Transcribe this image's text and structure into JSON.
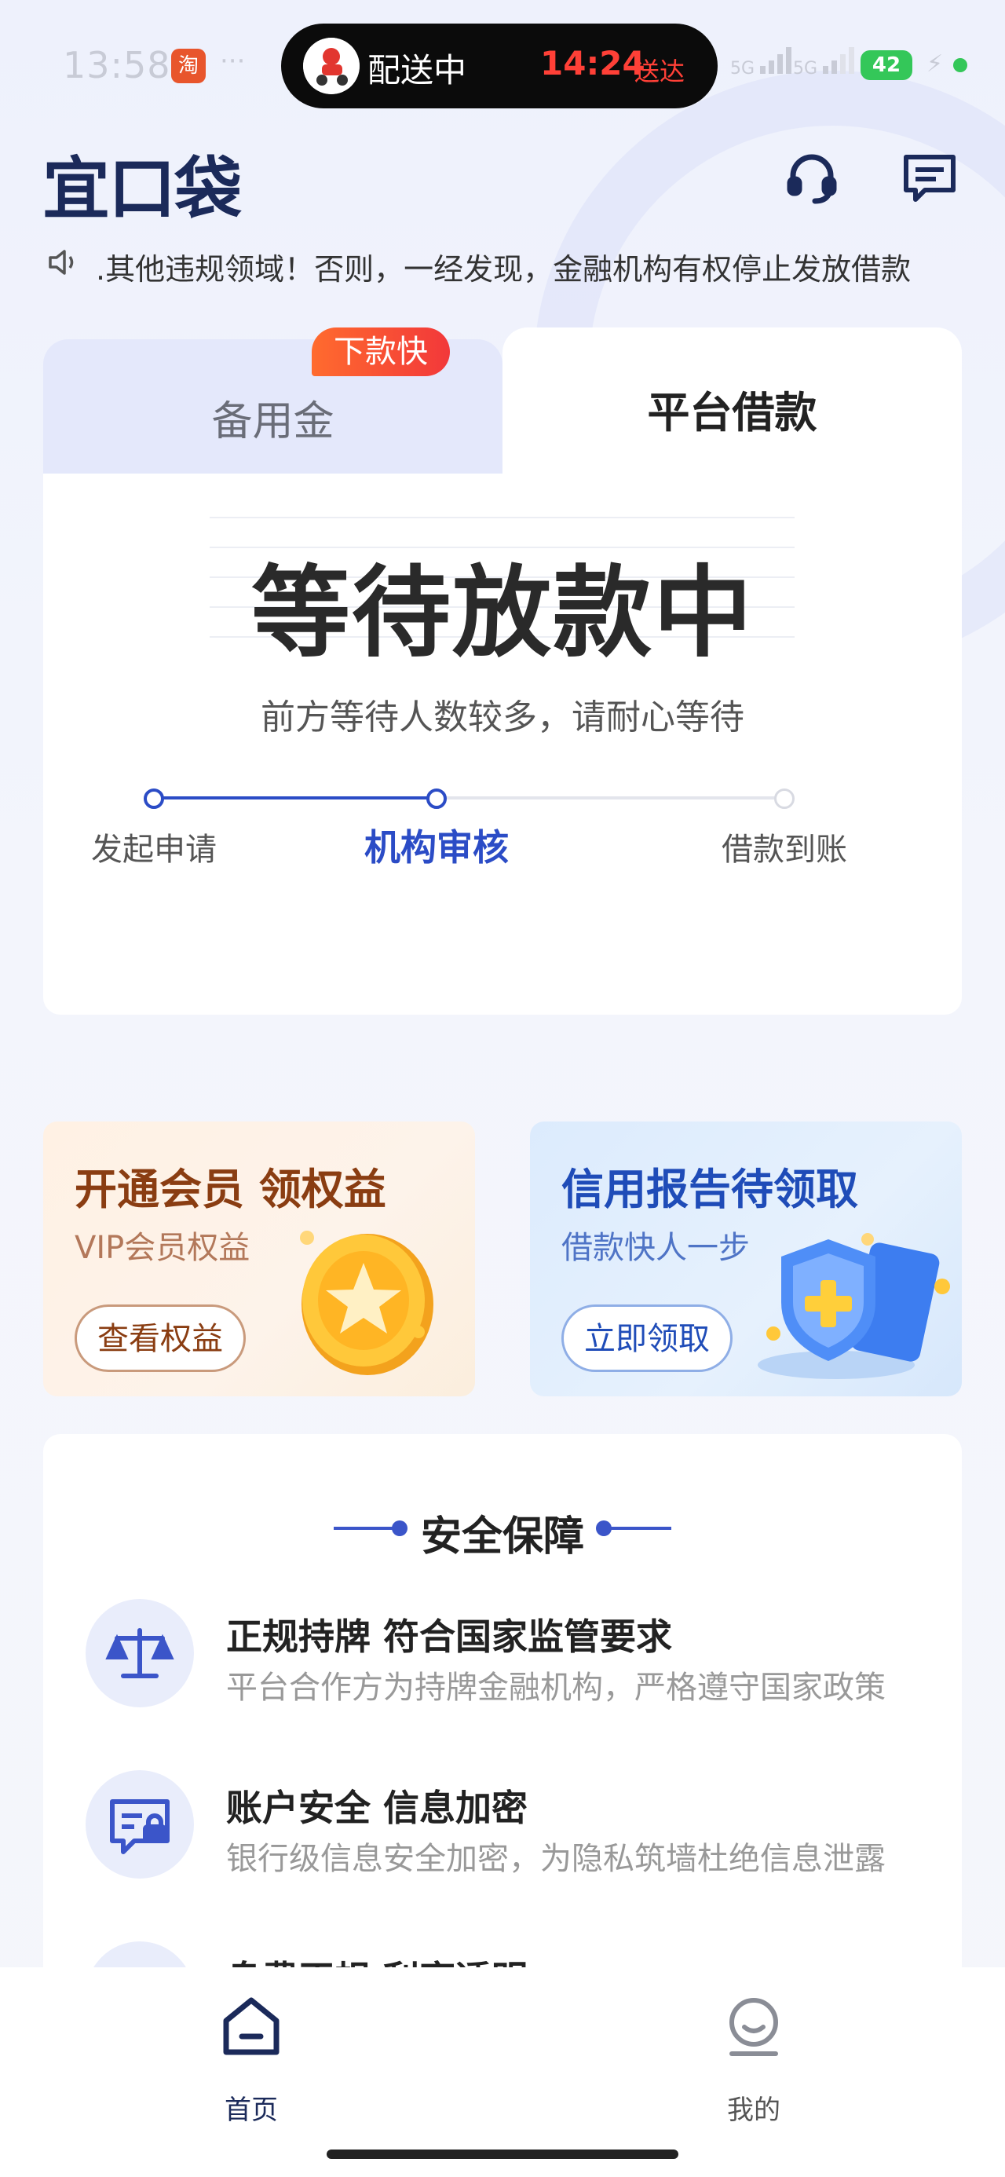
{
  "status_bar": {
    "time": "13:58",
    "app_icon_glyph": "淘",
    "more_dots": "···",
    "delivery_status": "配送中",
    "delivery_time": "14:24",
    "delivery_suffix": "送达",
    "signal_1": "5G",
    "signal_2": "5G",
    "battery": "42"
  },
  "header": {
    "brand": "宜口袋",
    "icons": [
      "headset-icon",
      "message-icon"
    ]
  },
  "notice": {
    "icon": "speaker-icon",
    "text": ".其他违规领域！否则，一经发现，金融机构有权停止发放借款"
  },
  "loan_card": {
    "tab_left": "备用金",
    "tab_left_badge": "下款快",
    "tab_right": "平台借款",
    "status": "等待放款中",
    "subtitle": "前方等待人数较多，请耐心等待",
    "steps": [
      {
        "label": "发起申请",
        "state": "done"
      },
      {
        "label": "机构审核",
        "state": "active"
      },
      {
        "label": "借款到账",
        "state": "pending"
      }
    ],
    "colors": {
      "accent": "#2b4cc6",
      "inactive": "#d8dae2"
    }
  },
  "promos": [
    {
      "title": "开通会员 领权益",
      "subtitle": "VIP会员权益",
      "button": "查看权益",
      "icon": "star-coin-icon"
    },
    {
      "title": "信用报告待领取",
      "subtitle": "借款快人一步",
      "button": "立即领取",
      "icon": "shield-icon"
    }
  ],
  "security": {
    "title": "安全保障",
    "items": [
      {
        "title": "正规持牌 符合国家监管要求",
        "desc": "平台合作方为持牌金融机构，严格遵守国家政策",
        "icon": "balance-scale-icon"
      },
      {
        "title": "账户安全 信息加密",
        "desc": "银行级信息安全加密，为隐私筑墙杜绝信息泄露",
        "icon": "secure-card-icon"
      },
      {
        "title": "息费正规 利率透明",
        "desc": "",
        "icon": "coin-icon"
      }
    ]
  },
  "tabbar": {
    "items": [
      {
        "label": "首页",
        "icon": "home-icon",
        "active": true
      },
      {
        "label": "我的",
        "icon": "profile-icon",
        "active": false
      }
    ]
  }
}
